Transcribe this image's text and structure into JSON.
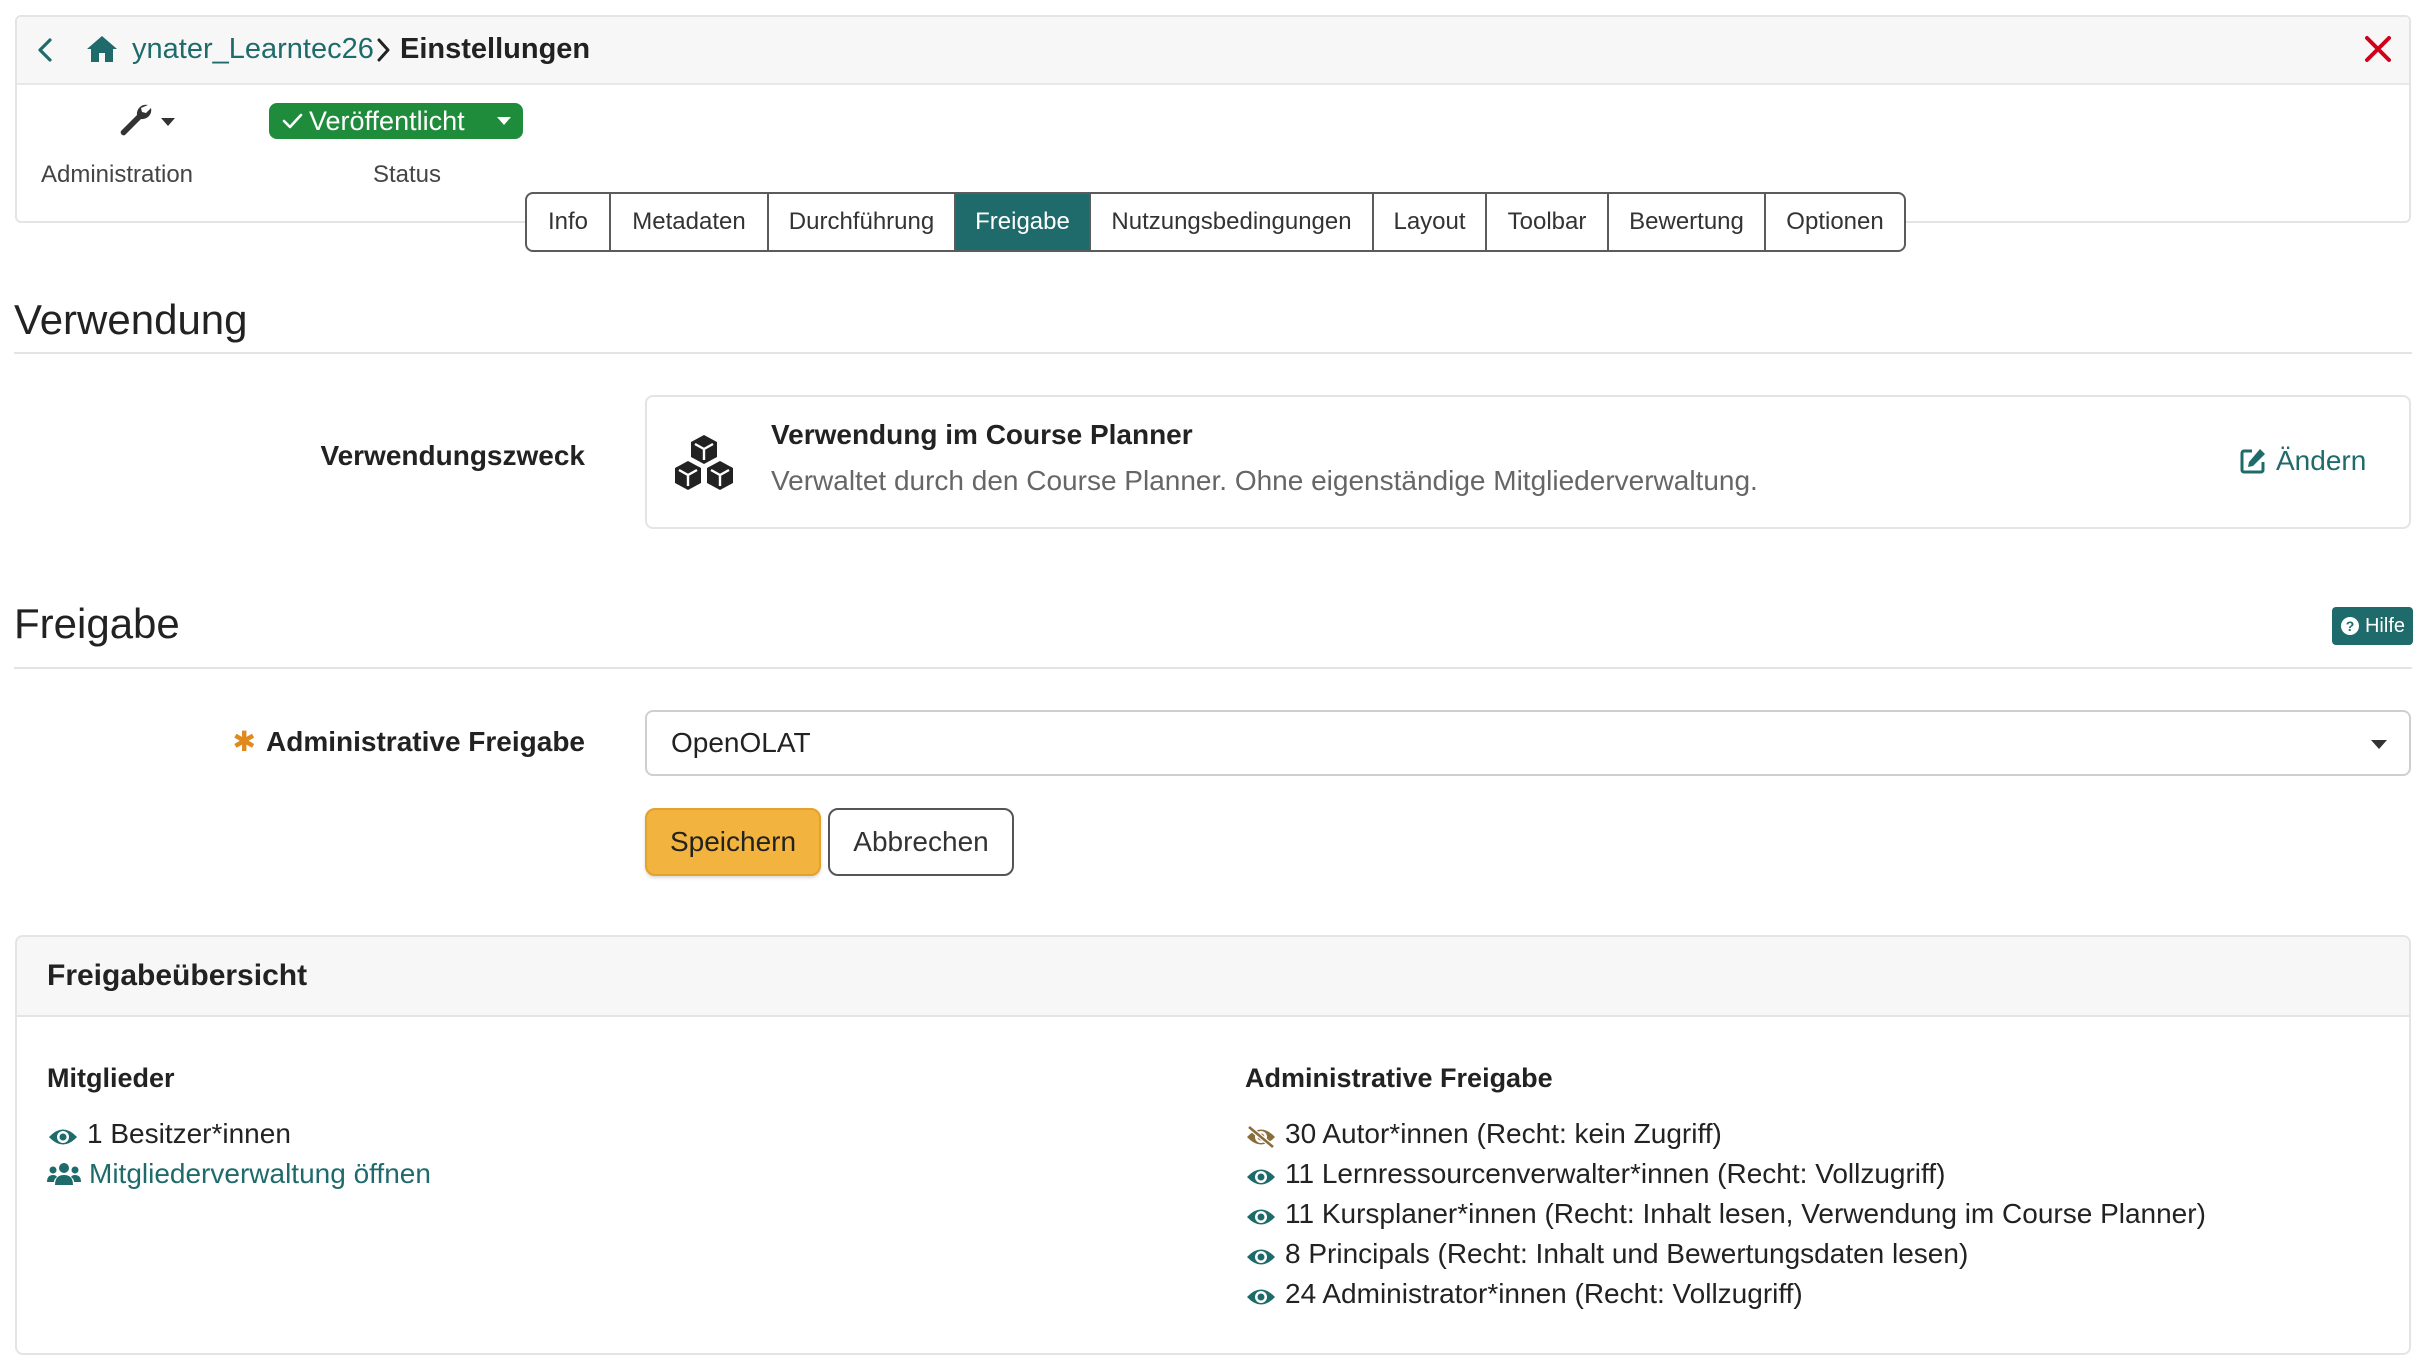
{
  "header": {
    "breadcrumb_repo": "ynater_Learntec26",
    "breadcrumb_current": "Einstellungen"
  },
  "toolbar": {
    "administration_label": "Administration",
    "status_value": "Veröffentlicht",
    "status_label": "Status"
  },
  "tabs": [
    {
      "label": "Info"
    },
    {
      "label": "Metadaten"
    },
    {
      "label": "Durchführung"
    },
    {
      "label": "Freigabe",
      "active": true
    },
    {
      "label": "Nutzungsbedingungen"
    },
    {
      "label": "Layout"
    },
    {
      "label": "Toolbar"
    },
    {
      "label": "Bewertung"
    },
    {
      "label": "Optionen"
    }
  ],
  "usage": {
    "section_title": "Verwendung",
    "field_label": "Verwendungszweck",
    "card_title": "Verwendung im Course Planner",
    "card_desc": "Verwaltet durch den Course Planner. Ohne eigenständige Mitgliederverwaltung.",
    "change_label": "Ändern"
  },
  "release": {
    "section_title": "Freigabe",
    "help_label": "Hilfe",
    "required_marker": "✱",
    "field_label": "Administrative Freigabe",
    "selected_value": "OpenOLAT",
    "save_label": "Speichern",
    "cancel_label": "Abbrechen"
  },
  "overview": {
    "title": "Freigabeübersicht",
    "members_title": "Mitglieder",
    "members_owners": "1 Besitzer*innen",
    "members_link": "Mitgliederverwaltung öffnen",
    "admin_title": "Administrative Freigabe",
    "admin_items": [
      {
        "text": "30 Autor*innen (Recht: kein Zugriff)",
        "icon": "eye-slash"
      },
      {
        "text": "11 Lernressourcenverwalter*innen (Recht: Vollzugriff)",
        "icon": "eye"
      },
      {
        "text": "11 Kursplaner*innen (Recht: Inhalt lesen, Verwendung im Course Planner)",
        "icon": "eye"
      },
      {
        "text": "8 Principals (Recht: Inhalt und Bewertungsdaten lesen)",
        "icon": "eye"
      },
      {
        "text": "24 Administrator*innen (Recht: Vollzugriff)",
        "icon": "eye"
      }
    ]
  },
  "colors": {
    "accent": "#1f6b6b",
    "published": "#1f8c3c",
    "save_button": "#f2b43e",
    "close_icon": "#d0021b",
    "required": "#e08a1e"
  }
}
